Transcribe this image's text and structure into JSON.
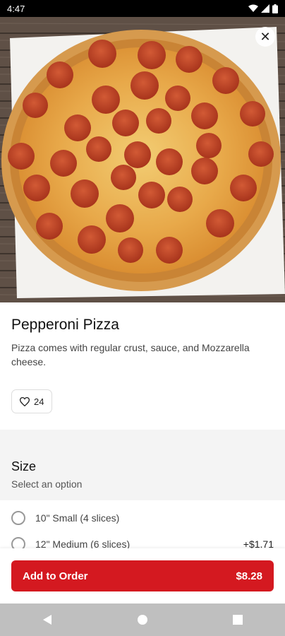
{
  "status_bar": {
    "time": "4:47"
  },
  "item": {
    "name": "Pepperoni Pizza",
    "description": "Pizza comes with regular crust, sauce, and Mozzarella cheese.",
    "likes": "24"
  },
  "size": {
    "title": "Size",
    "subtitle": "Select an option",
    "options": [
      {
        "label": "10\" Small (4 slices)",
        "price": ""
      },
      {
        "label": "12\" Medium (6 slices)",
        "price": "+$1.71"
      }
    ]
  },
  "order": {
    "label": "Add to Order",
    "total": "$8.28"
  },
  "colors": {
    "accent": "#d41920"
  }
}
